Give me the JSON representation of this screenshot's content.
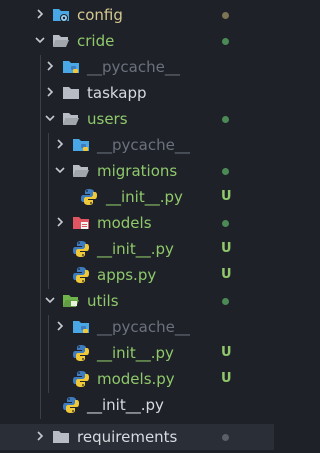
{
  "colors": {
    "background": "#1e2127",
    "text_default": "#d7dae0",
    "text_dim": "#6b717d",
    "text_green": "#8fc96b",
    "status_green": "#4c8a55",
    "status_olive": "#7d7456",
    "folder_gray": "#b8bcc4",
    "folder_blue": "#4aa7e6",
    "folder_green": "#6fb44a",
    "folder_red": "#e05561",
    "python_blue": "#3e7bbf",
    "python_yellow": "#f0c93a"
  },
  "explorer": {
    "items": [
      {
        "label": "config",
        "indent": 0,
        "arrow": "right",
        "icon": "folder-gear-icon",
        "color": "text_olive",
        "status": "dot-olive"
      },
      {
        "label": "cride",
        "indent": 0,
        "arrow": "down",
        "icon": "folder-open-icon",
        "color": "text_green",
        "status": "dot-green"
      },
      {
        "label": "__pycache__",
        "indent": 1,
        "arrow": "right",
        "icon": "folder-python-icon",
        "color": "text_dim",
        "status": ""
      },
      {
        "label": "taskapp",
        "indent": 1,
        "arrow": "right",
        "icon": "folder-icon",
        "color": "text_default",
        "status": ""
      },
      {
        "label": "users",
        "indent": 1,
        "arrow": "down",
        "icon": "folder-open-icon",
        "color": "text_green",
        "status": "dot-green"
      },
      {
        "label": "__pycache__",
        "indent": 2,
        "arrow": "right",
        "icon": "folder-python-icon",
        "color": "text_dim",
        "status": ""
      },
      {
        "label": "migrations",
        "indent": 2,
        "arrow": "down",
        "icon": "folder-open-icon",
        "color": "text_green",
        "status": "dot-green"
      },
      {
        "label": "__init__.py",
        "indent": 3,
        "arrow": "",
        "icon": "python-file-icon",
        "color": "text_green",
        "status": "U"
      },
      {
        "label": "models",
        "indent": 2,
        "arrow": "right",
        "icon": "folder-models-icon",
        "color": "text_green",
        "status": "dot-green"
      },
      {
        "label": "__init__.py",
        "indent": 2,
        "arrow": "",
        "icon": "python-file-icon",
        "color": "text_green",
        "status": "U"
      },
      {
        "label": "apps.py",
        "indent": 2,
        "arrow": "",
        "icon": "python-file-icon",
        "color": "text_green",
        "status": "U"
      },
      {
        "label": "utils",
        "indent": 1,
        "arrow": "down",
        "icon": "folder-utils-icon",
        "color": "text_green",
        "status": "dot-green"
      },
      {
        "label": "__pycache__",
        "indent": 2,
        "arrow": "right",
        "icon": "folder-python-icon",
        "color": "text_dim",
        "status": ""
      },
      {
        "label": "__init__.py",
        "indent": 2,
        "arrow": "",
        "icon": "python-file-icon",
        "color": "text_green",
        "status": "U"
      },
      {
        "label": "models.py",
        "indent": 2,
        "arrow": "",
        "icon": "python-file-icon",
        "color": "text_green",
        "status": "U"
      },
      {
        "label": "__init__.py",
        "indent": 1,
        "arrow": "",
        "icon": "python-file-icon",
        "color": "text_default",
        "status": ""
      },
      {
        "label": "requirements",
        "indent": 0,
        "arrow": "right",
        "icon": "folder-icon",
        "color": "text_default",
        "status": "dot-dim"
      }
    ]
  }
}
